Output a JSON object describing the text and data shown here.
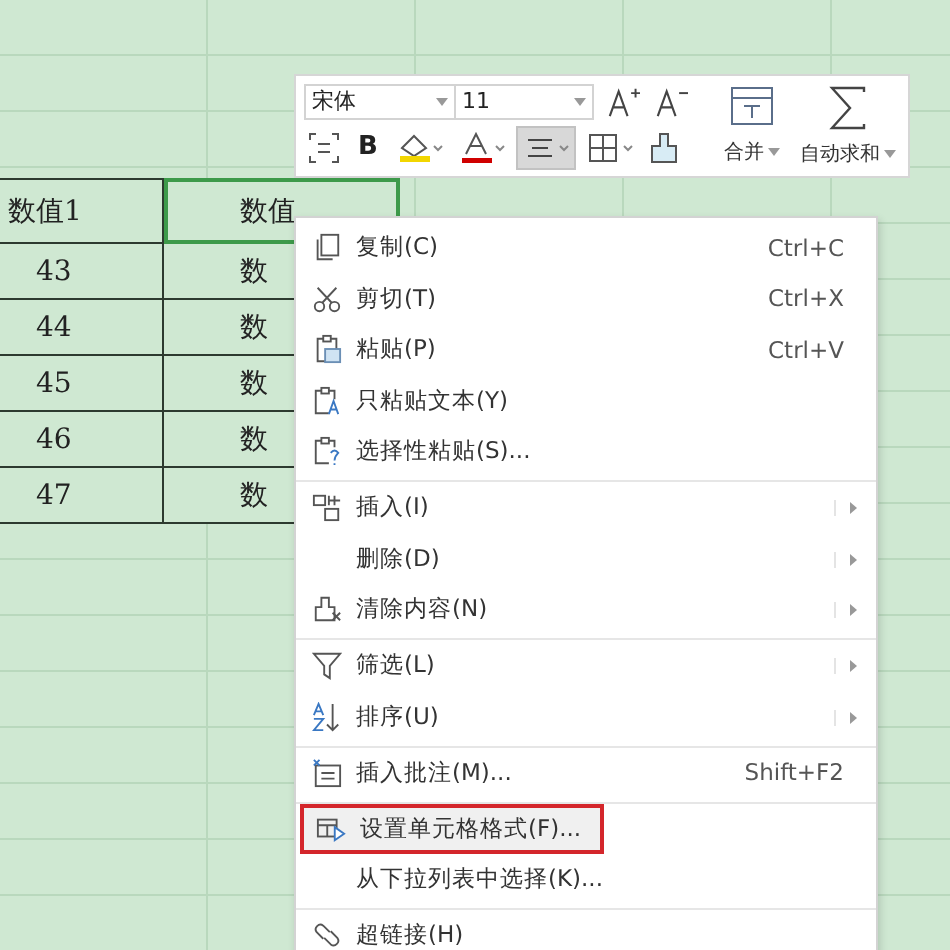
{
  "sheet": {
    "header": [
      "数值1",
      "数值"
    ],
    "rows": [
      [
        "43",
        "数"
      ],
      [
        "44",
        "数"
      ],
      [
        "45",
        "数"
      ],
      [
        "46",
        "数"
      ],
      [
        "47",
        "数"
      ]
    ]
  },
  "toolbar": {
    "font": "宋体",
    "size": "11",
    "tools": [
      {
        "kind": "wrap",
        "selected": false
      },
      {
        "kind": "bold",
        "label": "B",
        "selected": false
      },
      {
        "kind": "fill",
        "selected": false
      },
      {
        "kind": "fontcolor",
        "selected": false
      },
      {
        "kind": "align",
        "selected": true
      },
      {
        "kind": "border",
        "selected": false
      },
      {
        "kind": "brush",
        "selected": false
      }
    ],
    "big": [
      {
        "kind": "merge",
        "label": "合并"
      },
      {
        "kind": "sum",
        "label": "自动求和"
      }
    ]
  },
  "menu": [
    {
      "kind": "copy",
      "label": "复制(C)",
      "shortcut": "Ctrl+C",
      "submenu": false,
      "highlighted": false,
      "separator_after": false
    },
    {
      "kind": "cut",
      "label": "剪切(T)",
      "shortcut": "Ctrl+X",
      "submenu": false,
      "highlighted": false,
      "separator_after": false
    },
    {
      "kind": "paste",
      "label": "粘贴(P)",
      "shortcut": "Ctrl+V",
      "submenu": false,
      "highlighted": false,
      "separator_after": false
    },
    {
      "kind": "pastetext",
      "label": "只粘贴文本(Y)",
      "submenu": false,
      "highlighted": false,
      "separator_after": false
    },
    {
      "kind": "pastespecial",
      "label": "选择性粘贴(S)...",
      "submenu": false,
      "highlighted": false,
      "separator_after": true
    },
    {
      "kind": "insert",
      "label": "插入(I)",
      "submenu": true,
      "highlighted": false,
      "separator_after": false
    },
    {
      "kind": "plain",
      "label": "删除(D)",
      "submenu": true,
      "highlighted": false,
      "separator_after": false
    },
    {
      "kind": "clear",
      "label": "清除内容(N)",
      "submenu": true,
      "highlighted": false,
      "separator_after": true
    },
    {
      "kind": "filter",
      "label": "筛选(L)",
      "submenu": true,
      "highlighted": false,
      "separator_after": false
    },
    {
      "kind": "sort",
      "label": "排序(U)",
      "submenu": true,
      "highlighted": false,
      "separator_after": true
    },
    {
      "kind": "comment",
      "label": "插入批注(M)...",
      "shortcut": "Shift+F2",
      "submenu": false,
      "highlighted": false,
      "separator_after": true
    },
    {
      "kind": "format",
      "label": "设置单元格格式(F)...",
      "submenu": false,
      "highlighted": true,
      "separator_after": false
    },
    {
      "kind": "plain",
      "label": "从下拉列表中选择(K)...",
      "submenu": false,
      "highlighted": false,
      "separator_after": true
    },
    {
      "kind": "link",
      "label": "超链接(H)",
      "submenu": false,
      "highlighted": false,
      "separator_after": false
    }
  ]
}
